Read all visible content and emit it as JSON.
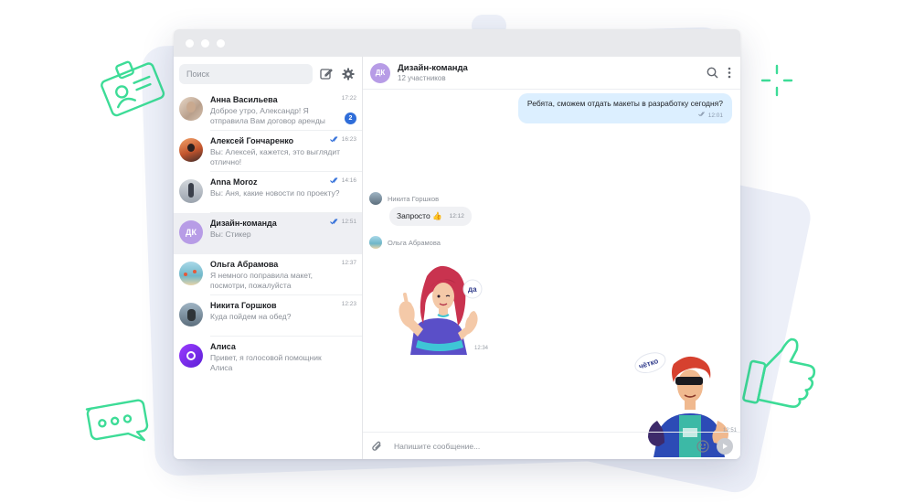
{
  "sidebar": {
    "search_placeholder": "Поиск",
    "chats": [
      {
        "name": "Анна Васильева",
        "preview": "Доброе утро, Александр! Я отправила Вам договор аренды",
        "time": "17:22",
        "badge": "2",
        "read": false
      },
      {
        "name": "Алексей Гончаренко",
        "preview": "Вы: Алексей, кажется, это выглядит отлично!",
        "time": "16:23",
        "read": true
      },
      {
        "name": "Anna Moroz",
        "preview": "Вы: Аня, какие новости по проекту?",
        "time": "14:16",
        "read": true
      },
      {
        "name": "Дизайн-команда",
        "preview": "Вы: Стикер",
        "time": "12:51",
        "read": true,
        "avatar_initials": "ДК"
      },
      {
        "name": "Ольга Абрамова",
        "preview": "Я немного поправила макет, посмотри, пожалуйста",
        "time": "12:37",
        "read": false
      },
      {
        "name": "Никита Горшков",
        "preview": "Куда пойдем на обед?",
        "time": "12:23",
        "read": false
      },
      {
        "name": "Алиса",
        "preview": "Привет, я голосовой помощник Алиса",
        "time": "",
        "read": false
      }
    ]
  },
  "chat": {
    "avatar_initials": "ДК",
    "title": "Дизайн-команда",
    "subtitle": "12 участников",
    "messages": {
      "outgoing_text": "Ребята, сможем отдать макеты в разработку сегодня?",
      "outgoing_time": "12:01",
      "sender1": "Никита Горшков",
      "incoming_text": "Запросто 👍",
      "incoming_time": "12:12",
      "sender2": "Ольга Абрамова",
      "sticker1_text": "да",
      "sticker1_time": "12:34",
      "sticker2_text": "чётко",
      "sticker2_time": "12:51"
    },
    "composer_placeholder": "Напишите сообщение..."
  },
  "colors": {
    "accent": "#2f6dd9",
    "group_avatar": "#b79ce6",
    "outgoing_bubble": "#dcefff",
    "deco_green": "#3ddc97",
    "alice_purple": "#7b2ff7"
  }
}
